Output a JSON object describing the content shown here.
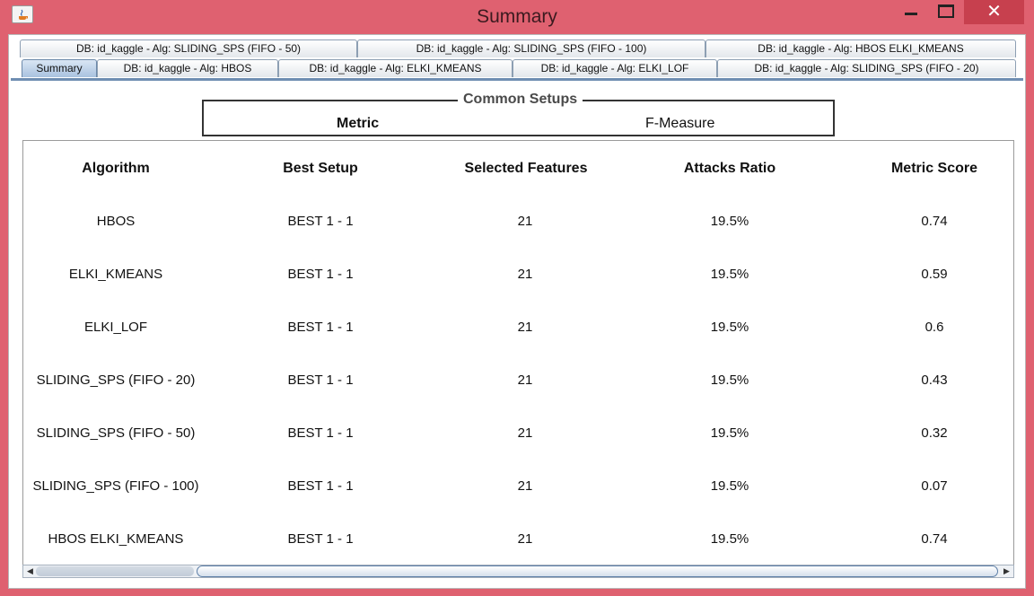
{
  "window": {
    "title": "Summary",
    "close_glyph": "✕"
  },
  "tabs": {
    "row1": [
      {
        "label": "DB: id_kaggle - Alg: SLIDING_SPS (FIFO - 50)"
      },
      {
        "label": "DB: id_kaggle - Alg: SLIDING_SPS (FIFO - 100)"
      },
      {
        "label": "DB: id_kaggle - Alg: HBOS ELKI_KMEANS"
      }
    ],
    "row2": [
      {
        "label": "Summary",
        "active": true
      },
      {
        "label": "DB: id_kaggle - Alg: HBOS"
      },
      {
        "label": "DB: id_kaggle - Alg: ELKI_KMEANS"
      },
      {
        "label": "DB: id_kaggle - Alg: ELKI_LOF"
      },
      {
        "label": "DB: id_kaggle - Alg: SLIDING_SPS (FIFO - 20)"
      }
    ]
  },
  "common_setups": {
    "legend": "Common Setups",
    "metric_label": "Metric",
    "metric_value": "F-Measure"
  },
  "table": {
    "columns": [
      "Algorithm",
      "Best Setup",
      "Selected Features",
      "Attacks Ratio",
      "Metric Score"
    ],
    "rows": [
      [
        "HBOS",
        "BEST 1 - 1",
        "21",
        "19.5%",
        "0.74"
      ],
      [
        "ELKI_KMEANS",
        "BEST 1 - 1",
        "21",
        "19.5%",
        "0.59"
      ],
      [
        "ELKI_LOF",
        "BEST 1 - 1",
        "21",
        "19.5%",
        "0.6"
      ],
      [
        "SLIDING_SPS (FIFO - 20)",
        "BEST 1 - 1",
        "21",
        "19.5%",
        "0.43"
      ],
      [
        "SLIDING_SPS (FIFO - 50)",
        "BEST 1 - 1",
        "21",
        "19.5%",
        "0.32"
      ],
      [
        "SLIDING_SPS (FIFO - 100)",
        "BEST 1 - 1",
        "21",
        "19.5%",
        "0.07"
      ],
      [
        "HBOS ELKI_KMEANS",
        "BEST 1 - 1",
        "21",
        "19.5%",
        "0.74"
      ]
    ]
  },
  "scrollbar": {
    "left_arrow": "◀",
    "right_arrow": "▶"
  },
  "colors": {
    "window_frame": "#df6170",
    "close_button": "#c7404e",
    "active_tab": "#a9c2df"
  }
}
